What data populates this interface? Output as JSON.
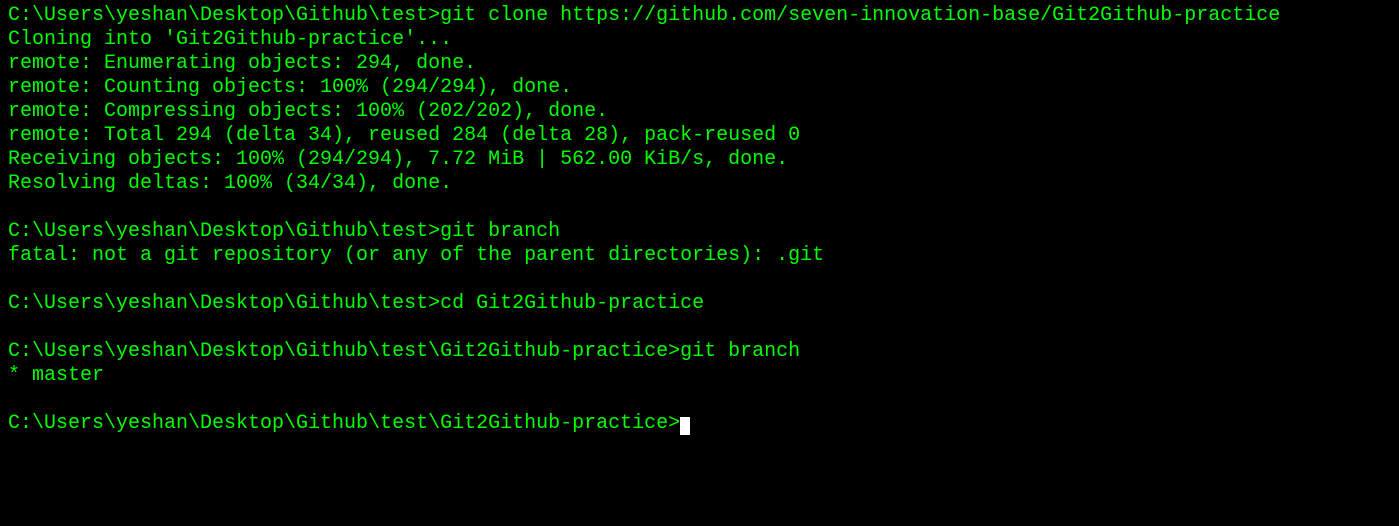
{
  "terminal": {
    "lines": [
      {
        "prompt": "C:\\Users\\yeshan\\Desktop\\Github\\test>",
        "command": "git clone https://github.com/seven-innovation-base/Git2Github-practice"
      },
      {
        "output": "Cloning into 'Git2Github-practice'..."
      },
      {
        "output": "remote: Enumerating objects: 294, done."
      },
      {
        "output": "remote: Counting objects: 100% (294/294), done."
      },
      {
        "output": "remote: Compressing objects: 100% (202/202), done."
      },
      {
        "output": "remote: Total 294 (delta 34), reused 284 (delta 28), pack-reused 0"
      },
      {
        "output": "Receiving objects: 100% (294/294), 7.72 MiB | 562.00 KiB/s, done."
      },
      {
        "output": "Resolving deltas: 100% (34/34), done."
      },
      {
        "output": ""
      },
      {
        "prompt": "C:\\Users\\yeshan\\Desktop\\Github\\test>",
        "command": "git branch"
      },
      {
        "output": "fatal: not a git repository (or any of the parent directories): .git"
      },
      {
        "output": ""
      },
      {
        "prompt": "C:\\Users\\yeshan\\Desktop\\Github\\test>",
        "command": "cd Git2Github-practice"
      },
      {
        "output": ""
      },
      {
        "prompt": "C:\\Users\\yeshan\\Desktop\\Github\\test\\Git2Github-practice>",
        "command": "git branch"
      },
      {
        "output": "* master"
      },
      {
        "output": ""
      },
      {
        "prompt": "C:\\Users\\yeshan\\Desktop\\Github\\test\\Git2Github-practice>",
        "command": "",
        "cursor": true
      }
    ]
  }
}
